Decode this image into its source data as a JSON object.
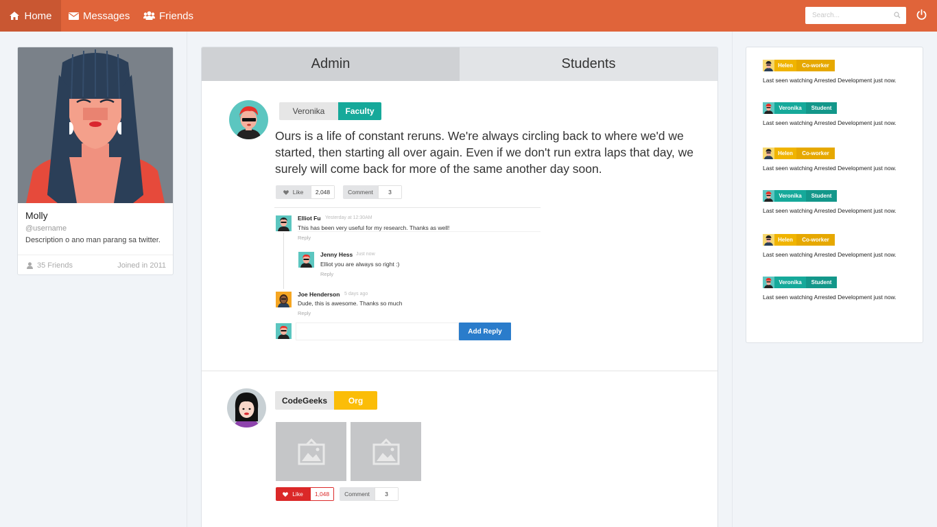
{
  "nav": {
    "items": [
      {
        "label": "Home",
        "icon": "home-icon"
      },
      {
        "label": "Messages",
        "icon": "envelope-icon"
      },
      {
        "label": "Friends",
        "icon": "users-icon"
      }
    ],
    "search_placeholder": "Search...",
    "accent": "#e0643a"
  },
  "profile": {
    "name": "Molly",
    "username": "@username",
    "description": "Description o ano man parang sa twitter.",
    "friends": "35 Friends",
    "joined": "Joined in 2011"
  },
  "tabs": {
    "admin": "Admin",
    "students": "Students"
  },
  "post1": {
    "author": "Veronika",
    "role": "Faculty",
    "text": "Ours is a life of constant reruns. We're always circling back to where we'd we started, then starting all over again. Even if we don't run extra laps that day, we surely will come back for more of the same another day soon.",
    "like_label": "Like",
    "like_count": "2,048",
    "comment_label": "Comment",
    "comment_count": "3",
    "comments": [
      {
        "name": "Elliot Fu",
        "time": "Yesterday at 12:30AM",
        "text": "This has been very useful for my research. Thanks as well!",
        "reply": "Reply"
      },
      {
        "name": "Jenny Hess",
        "time": "Just now",
        "text": "Elliot you are always so right :)",
        "reply": "Reply"
      },
      {
        "name": "Joe Henderson",
        "time": "5 days ago",
        "text": "Dude, this is awesome. Thanks so much",
        "reply": "Reply"
      }
    ],
    "add_reply": "Add Reply"
  },
  "post2": {
    "author": "CodeGeeks",
    "role": "Org",
    "like_label": "Like",
    "like_count": "1,048",
    "comment_label": "Comment",
    "comment_count": "3"
  },
  "activity": [
    {
      "name": "Helen",
      "role": "Co-worker",
      "text": "Last seen watching Arrested Development just now."
    },
    {
      "name": "Veronika",
      "role": "Student",
      "text": "Last seen watching Arrested Development just now."
    },
    {
      "name": "Helen",
      "role": "Co-worker",
      "text": "Last seen watching Arrested Development just now."
    },
    {
      "name": "Veronika",
      "role": "Student",
      "text": "Last seen watching Arrested Development just now."
    },
    {
      "name": "Helen",
      "role": "Co-worker",
      "text": "Last seen watching Arrested Development just now."
    },
    {
      "name": "Veronika",
      "role": "Student",
      "text": "Last seen watching Arrested Development just now."
    }
  ],
  "colors": {
    "faculty": "#16a99a",
    "student": "#16a99a",
    "coworker": "#f0b400",
    "org": "#fbbd08",
    "like_active": "#db2828",
    "add_reply": "#2a7ccb"
  }
}
